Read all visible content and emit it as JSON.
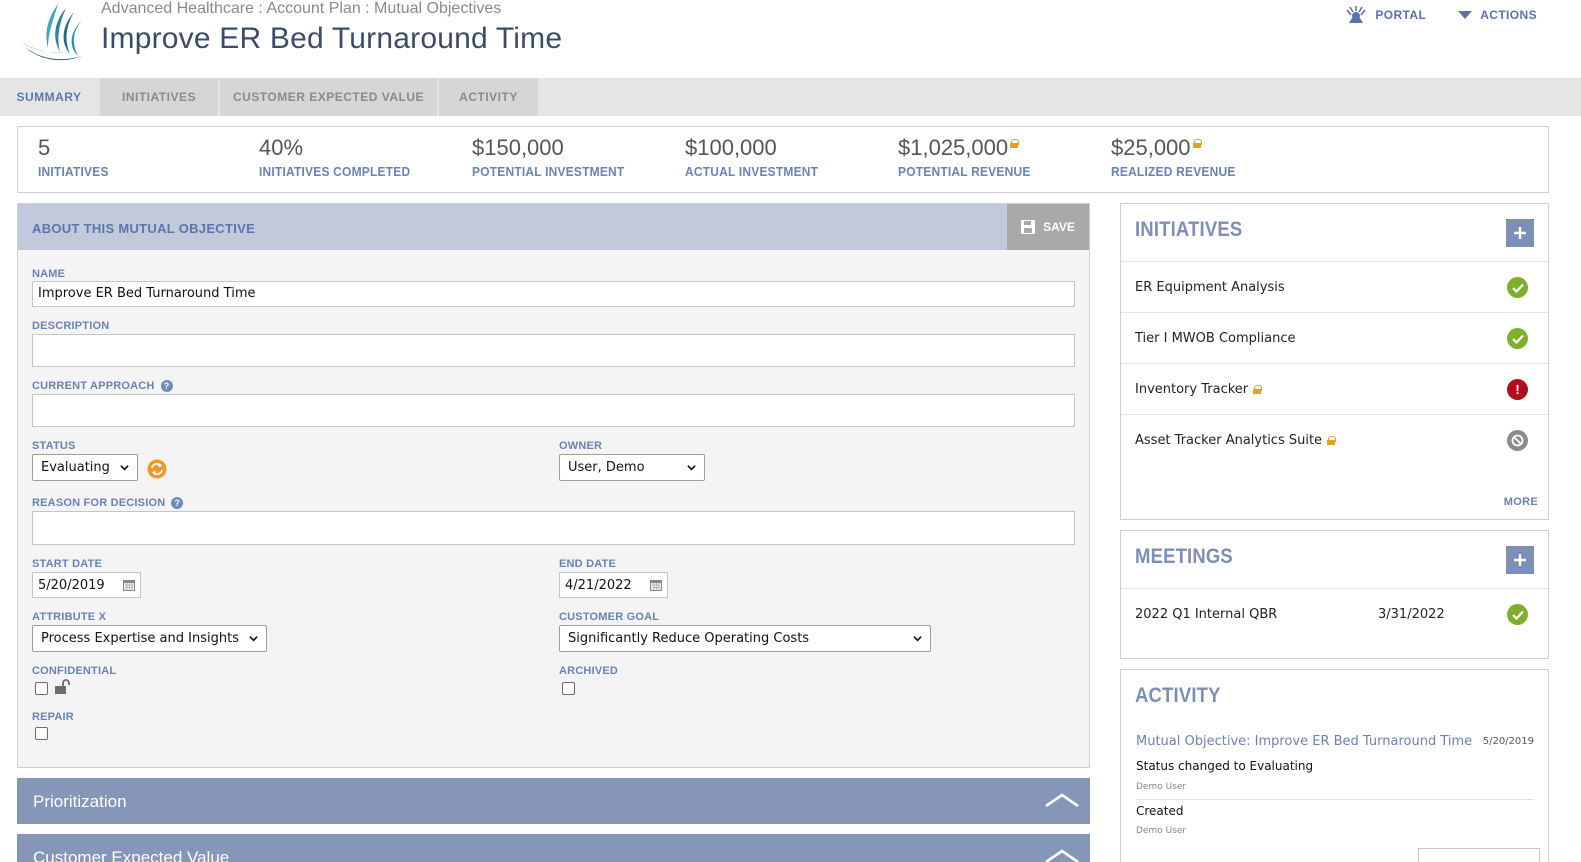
{
  "header": {
    "breadcrumb": "Advanced Healthcare : Account Plan : Mutual Objectives",
    "title": "Improve ER Bed Turnaround Time",
    "portal_label": "PORTAL",
    "actions_label": "ACTIONS"
  },
  "tabs": [
    {
      "label": "SUMMARY",
      "active": true
    },
    {
      "label": "INITIATIVES",
      "active": false
    },
    {
      "label": "CUSTOMER EXPECTED VALUE",
      "active": false
    },
    {
      "label": "ACTIVITY",
      "active": false
    }
  ],
  "kpis": [
    {
      "value": "5",
      "label": "INITIATIVES",
      "locked": false
    },
    {
      "value": "40%",
      "label": "INITIATIVES COMPLETED",
      "locked": false
    },
    {
      "value": "$150,000",
      "label": "POTENTIAL INVESTMENT",
      "locked": false
    },
    {
      "value": "$100,000",
      "label": "ACTUAL INVESTMENT",
      "locked": false
    },
    {
      "value": "$1,025,000",
      "label": "POTENTIAL REVENUE",
      "locked": true
    },
    {
      "value": "$25,000",
      "label": "REALIZED REVENUE",
      "locked": true
    }
  ],
  "about": {
    "title": "ABOUT THIS MUTUAL OBJECTIVE",
    "save_label": "SAVE",
    "name_label": "NAME",
    "name_value": "Improve ER Bed Turnaround Time",
    "description_label": "DESCRIPTION",
    "description_value": "",
    "approach_label": "CURRENT APPROACH",
    "approach_value": "",
    "status_label": "STATUS",
    "status_value": "Evaluating",
    "owner_label": "OWNER",
    "owner_value": "User, Demo",
    "reason_label": "REASON FOR DECISION",
    "reason_value": "",
    "start_label": "START DATE",
    "start_value": "5/20/2019",
    "end_label": "END DATE",
    "end_value": "4/21/2022",
    "attribute_label": "ATTRIBUTE X",
    "attribute_value": "Process Expertise and Insights",
    "goal_label": "CUSTOMER GOAL",
    "goal_value": "Significantly Reduce Operating Costs",
    "confidential_label": "CONFIDENTIAL",
    "confidential_checked": false,
    "archived_label": "ARCHIVED",
    "archived_checked": false,
    "repair_label": "REPAIR",
    "repair_checked": false
  },
  "sections": {
    "prioritization": "Prioritization",
    "customer_expected_value": "Customer Expected Value"
  },
  "initiatives": {
    "title": "INITIATIVES",
    "more_label": "MORE",
    "items": [
      {
        "name": "ER Equipment Analysis",
        "locked": false,
        "status": "complete",
        "status_color": "#7fb02c"
      },
      {
        "name": "Tier I MWOB Compliance",
        "locked": false,
        "status": "complete",
        "status_color": "#7fb02c"
      },
      {
        "name": "Inventory Tracker",
        "locked": true,
        "status": "alert",
        "status_color": "#b00f1c"
      },
      {
        "name": "Asset Tracker Analytics Suite",
        "locked": true,
        "status": "cancelled",
        "status_color": "#8c8c8c"
      }
    ]
  },
  "meetings": {
    "title": "MEETINGS",
    "items": [
      {
        "name": "2022 Q1 Internal QBR",
        "date": "3/31/2022",
        "status": "complete"
      }
    ]
  },
  "activity": {
    "title": "ACTIVITY",
    "link": "Mutual Objective: Improve ER Bed Turnaround Time",
    "date": "5/20/2019",
    "entries": [
      {
        "text": "Status changed to Evaluating",
        "user": "Demo User"
      },
      {
        "text": "Created",
        "user": "Demo User"
      }
    ]
  },
  "colors": {
    "accent": "#6b82b5",
    "header_band": "#c1c9da",
    "collapse_bar": "#8596b9",
    "lock": "#e5a21c"
  }
}
